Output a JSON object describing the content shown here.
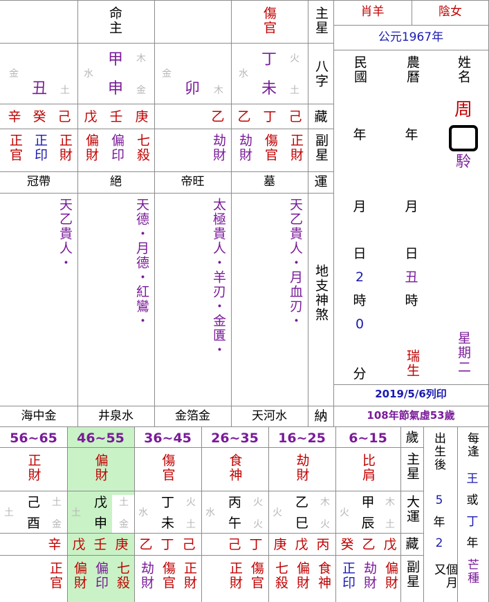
{
  "top": {
    "col1": "命主",
    "col3": "傷官",
    "zhuxing": "主星",
    "bazi": "八字",
    "cang": "藏",
    "fuxing": "副星",
    "yun": "運",
    "shensha": "地支神煞",
    "na": "納"
  },
  "info": {
    "zodiac": "肖羊",
    "gender": "陰女",
    "year": "公元1967年",
    "minguo": "民國",
    "nongli": "農曆",
    "xingming": "姓名",
    "nian1": "年",
    "nian2": "年",
    "yue1": "月",
    "yue2": "月",
    "ri1": "日",
    "ri2": "日",
    "ri1v": "2",
    "ri2v": "丑",
    "shi1": "時",
    "shi2": "時",
    "shi1v": "0",
    "fen": "分",
    "ruisheng": "瑞生",
    "xingqi": "星期二",
    "surname": "周",
    "given2": "駖",
    "print": "2019/5/6列印",
    "jieqi": "108年節氣虛53歲"
  },
  "pillars": [
    {
      "stem": "",
      "stemL": "",
      "stemR": "",
      "branch": "丑",
      "branchL": "金",
      "branchR": "土",
      "hidden": [
        "辛",
        "癸",
        "己"
      ],
      "sub": [
        "正官",
        "正印",
        "正財"
      ],
      "stage": "冠帶",
      "shen": "天乙貴人・",
      "nayin": "海中金"
    },
    {
      "stem": "甲",
      "stemL": "水",
      "stemR": "木",
      "branch": "申",
      "branchL": "",
      "branchR": "金",
      "hidden": [
        "戊",
        "壬",
        "庚"
      ],
      "sub": [
        "偏財",
        "偏印",
        "七殺"
      ],
      "stage": "絕",
      "shen": "天德・月德・紅鸞・",
      "nayin": "井泉水"
    },
    {
      "stem": "",
      "stemL": "金",
      "stemR": "",
      "branch": "卯",
      "branchL": "",
      "branchR": "木",
      "hidden": [
        "",
        "",
        "乙"
      ],
      "sub": [
        "",
        "",
        "劫財"
      ],
      "stage": "帝旺",
      "shen": "太極貴人・羊刃・金匱・",
      "nayin": "金箔金"
    },
    {
      "stem": "丁",
      "stemL": "水",
      "stemR": "火",
      "branch": "未",
      "branchL": "",
      "branchR": "土",
      "hidden": [
        "乙",
        "丁",
        "己"
      ],
      "sub": [
        "劫財",
        "傷官",
        "正財"
      ],
      "stage": "墓",
      "shen": "天乙貴人・月血刃・",
      "nayin": "天河水"
    }
  ],
  "dayun_labels": {
    "sui": "歲",
    "zhuxing": "主星",
    "dayun": "大運",
    "cang": "藏",
    "fuxing": "副星"
  },
  "dayun": [
    {
      "range": "56~65",
      "star": "正財",
      "stem": "己",
      "stemR": "土",
      "branchL": "土",
      "branch": "酉",
      "branchR": "金",
      "hidden": [
        "",
        "",
        "辛"
      ],
      "sub": [
        "",
        "",
        "正官"
      ]
    },
    {
      "range": "46~55",
      "star": "偏財",
      "stem": "戊",
      "stemR": "土",
      "branchL": "土",
      "branch": "申",
      "branchR": "金",
      "hidden": [
        "戊",
        "壬",
        "庚"
      ],
      "sub": [
        "偏財",
        "偏印",
        "七殺"
      ]
    },
    {
      "range": "36~45",
      "star": "傷官",
      "stem": "丁",
      "stemR": "火",
      "branchL": "水",
      "branch": "未",
      "branchR": "土",
      "hidden": [
        "乙",
        "丁",
        "己"
      ],
      "sub": [
        "劫財",
        "傷官",
        "正財"
      ]
    },
    {
      "range": "26~35",
      "star": "食神",
      "stem": "丙",
      "stemR": "火",
      "branchL": "水",
      "branch": "午",
      "branchR": "火",
      "hidden": [
        "",
        "己",
        "丁"
      ],
      "sub": [
        "",
        "正財",
        "傷官"
      ]
    },
    {
      "range": "16~25",
      "star": "劫財",
      "stem": "乙",
      "stemR": "木",
      "branchL": "火",
      "branch": "巳",
      "branchR": "火",
      "hidden": [
        "庚",
        "戊",
        "丙"
      ],
      "sub": [
        "七殺",
        "偏財",
        "食神"
      ]
    },
    {
      "range": "6~15",
      "star": "比肩",
      "stem": "甲",
      "stemR": "木",
      "branchL": "火",
      "branch": "辰",
      "branchR": "土",
      "hidden": [
        "癸",
        "乙",
        "戊"
      ],
      "sub": [
        "正印",
        "劫財",
        "偏財"
      ]
    }
  ],
  "birth": {
    "label": "出生後",
    "years": "5",
    "nian": "年",
    "months": "2",
    "geyue": "個月又",
    "mei": "每逢",
    "wang": "王",
    "huo": "或",
    "ding": "丁",
    "nian2": "年",
    "mangzhong": "芒種"
  }
}
